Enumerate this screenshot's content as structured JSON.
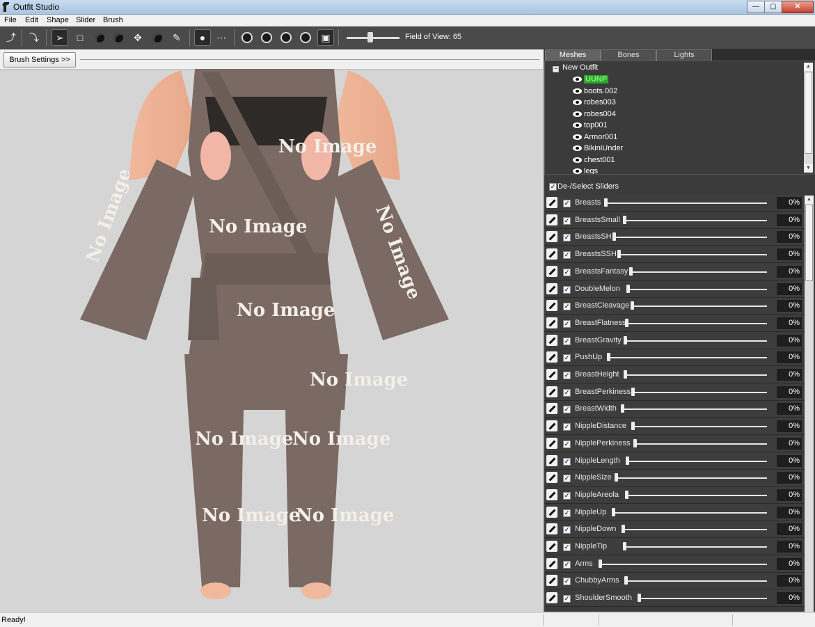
{
  "window": {
    "title": "Outfit Studio"
  },
  "menu": [
    "File",
    "Edit",
    "Shape",
    "Slider",
    "Brush"
  ],
  "toolbar": {
    "field_of_view_label": "Field of View: 65",
    "field_of_view_value": 65
  },
  "brush_settings_label": "Brush Settings >>",
  "viewport": {
    "texture_text": "No Image"
  },
  "tabs": [
    "Meshes",
    "Bones",
    "Lights"
  ],
  "tree": {
    "root": "New Outfit",
    "items": [
      "UUNP",
      "boots.002",
      "robes003",
      "robes004",
      "top001",
      "Armor001",
      "BikiniUnder",
      "chest001",
      "legs"
    ],
    "selected": "UUNP"
  },
  "sliders_header": "De-/Select Sliders",
  "sliders": [
    {
      "name": "Breasts",
      "value": "0%"
    },
    {
      "name": "BreastsSmall",
      "value": "0%"
    },
    {
      "name": "BreastsSH",
      "value": "0%"
    },
    {
      "name": "BreastsSSH",
      "value": "0%"
    },
    {
      "name": "BreastsFantasy",
      "value": "0%"
    },
    {
      "name": "DoubleMelon",
      "value": "0%"
    },
    {
      "name": "BreastCleavage",
      "value": "0%"
    },
    {
      "name": "BreastFlatness",
      "value": "0%"
    },
    {
      "name": "BreastGravity",
      "value": "0%"
    },
    {
      "name": "PushUp",
      "value": "0%"
    },
    {
      "name": "BreastHeight",
      "value": "0%"
    },
    {
      "name": "BreastPerkiness",
      "value": "0%"
    },
    {
      "name": "BreastWidth",
      "value": "0%"
    },
    {
      "name": "NippleDistance",
      "value": "0%"
    },
    {
      "name": "NipplePerkiness",
      "value": "0%"
    },
    {
      "name": "NippleLength",
      "value": "0%"
    },
    {
      "name": "NippleSize",
      "value": "0%"
    },
    {
      "name": "NippleAreola",
      "value": "0%"
    },
    {
      "name": "NippleUp",
      "value": "0%"
    },
    {
      "name": "NippleDown",
      "value": "0%"
    },
    {
      "name": "NippleTip",
      "value": "0%"
    },
    {
      "name": "Arms",
      "value": "0%"
    },
    {
      "name": "ChubbyArms",
      "value": "0%"
    },
    {
      "name": "ShoulderSmooth",
      "value": "0%"
    }
  ],
  "status": "Ready!"
}
